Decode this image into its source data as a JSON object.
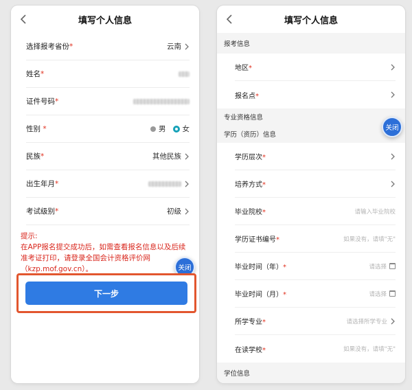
{
  "left": {
    "title": "填写个人信息",
    "rows": [
      {
        "label": "选择报考省份",
        "value": "云南"
      },
      {
        "label": "姓名",
        "value": ""
      },
      {
        "label": "证件号码",
        "value": ""
      },
      {
        "label": "性别",
        "male": "男",
        "female": "女"
      },
      {
        "label": "民族",
        "value": "其他民族"
      },
      {
        "label": "出生年月",
        "value": ""
      },
      {
        "label": "考试级别",
        "value": "初级"
      }
    ],
    "tip_title": "提示:",
    "tip_body": "在APP报名提交成功后，如需查看报名信息以及后续准考证打印，请登录全国会计资格评价网（kzp.mof.gov.cn）。",
    "next_label": "下一步",
    "close_label": "关闭"
  },
  "right": {
    "title": "填写个人信息",
    "section_exam": "报考信息",
    "exam_rows": [
      {
        "label": "地区"
      },
      {
        "label": "报名点"
      }
    ],
    "section_qual": "专业资格信息",
    "section_edu": "学历（资历）信息",
    "close_label": "关闭",
    "edu_rows": [
      {
        "label": "学历层次",
        "placeholder": ""
      },
      {
        "label": "培养方式",
        "placeholder": ""
      },
      {
        "label": "毕业院校",
        "placeholder": "请输入毕业院校"
      },
      {
        "label": "学历证书编号",
        "placeholder": "如果没有，请填\"无\""
      },
      {
        "label": "毕业时间（年）",
        "placeholder": "请选择"
      },
      {
        "label": "毕业时间（月）",
        "placeholder": "请选择"
      },
      {
        "label": "所学专业",
        "placeholder": "请选择所学专业"
      },
      {
        "label": "在读学校",
        "placeholder": "如果没有，请填\"无\""
      }
    ],
    "section_degree": "学位信息"
  },
  "required_mark": "*",
  "colors": {
    "accent": "#2f7be3",
    "required": "#e0301e",
    "highlight": "#e2562e"
  }
}
